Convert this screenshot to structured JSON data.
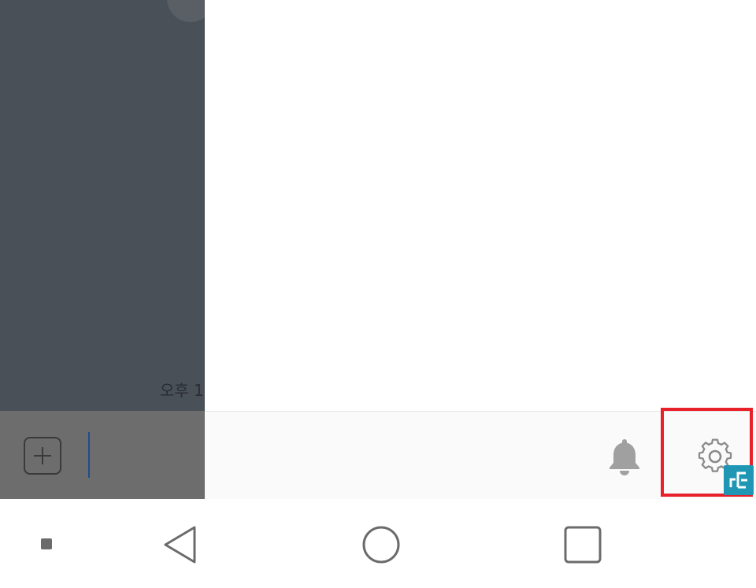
{
  "chat": {
    "timestamp": "오후 1"
  },
  "toolbar": {
    "notifications_icon": "bell-icon",
    "settings_icon": "gear-icon",
    "highlight_color": "#e8202a"
  },
  "navigation": {
    "buttons": [
      "dot",
      "back",
      "home",
      "recents"
    ]
  },
  "colors": {
    "badge": "#1e96b4",
    "chat_overlay": "#4a5058"
  }
}
